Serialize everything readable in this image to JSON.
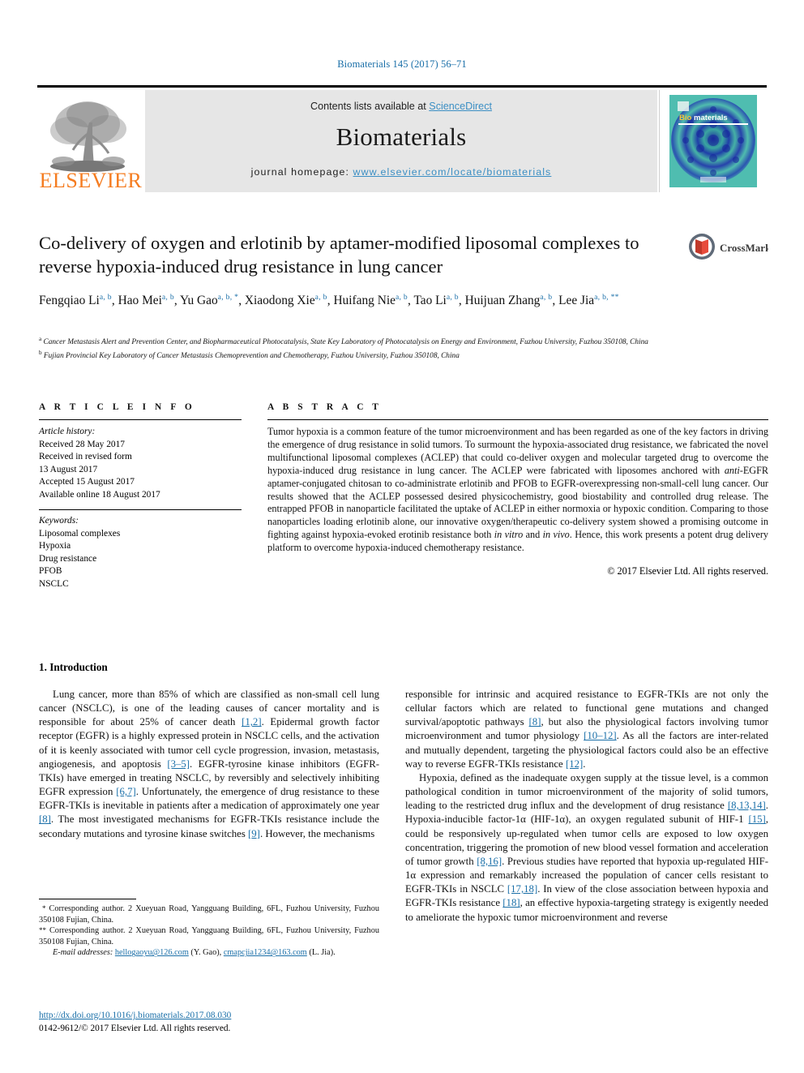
{
  "running_head": "Biomaterials 145 (2017) 56–71",
  "masthead": {
    "contents_prefix": "Contents lists available at ",
    "contents_link": "ScienceDirect",
    "journal_name": "Biomaterials",
    "homepage_prefix": "journal homepage: ",
    "homepage_url": "www.elsevier.com/locate/biomaterials",
    "publisher_logo_text": "ELSEVIER",
    "cover_title_a": "Bio",
    "cover_title_b": "materials"
  },
  "article": {
    "title": "Co-delivery of oxygen and erlotinib by aptamer-modified liposomal complexes to reverse hypoxia-induced drug resistance in lung cancer",
    "crossmark_label": "CrossMark",
    "authors": [
      {
        "name": "Fengqiao Li",
        "marks": "a, b",
        "sep": ", "
      },
      {
        "name": "Hao Mei",
        "marks": "a, b",
        "sep": ", "
      },
      {
        "name": "Yu Gao",
        "marks": "a, b, *",
        "sep": ", "
      },
      {
        "name": "Xiaodong Xie",
        "marks": "a, b",
        "sep": ", "
      },
      {
        "name": "Huifang Nie",
        "marks": "a, b",
        "sep": ", "
      },
      {
        "name": "Tao Li",
        "marks": "a, b",
        "sep": ", "
      },
      {
        "name": "Huijuan Zhang",
        "marks": "a, b",
        "sep": ", "
      },
      {
        "name": "Lee Jia",
        "marks": "a, b, **",
        "sep": ""
      }
    ],
    "affiliations": [
      {
        "mark": "a",
        "text": "Cancer Metastasis Alert and Prevention Center, and Biopharmaceutical Photocatalysis, State Key Laboratory of Photocatalysis on Energy and Environment, Fuzhou University, Fuzhou 350108, China"
      },
      {
        "mark": "b",
        "text": "Fujian Provincial Key Laboratory of Cancer Metastasis Chemoprevention and Chemotherapy, Fuzhou University, Fuzhou 350108, China"
      }
    ]
  },
  "article_info": {
    "heading": "A R T I C L E   I N F O",
    "history_label": "Article history:",
    "history": [
      "Received 28 May 2017",
      "Received in revised form",
      "13 August 2017",
      "Accepted 15 August 2017",
      "Available online 18 August 2017"
    ],
    "keywords_label": "Keywords:",
    "keywords": [
      "Liposomal complexes",
      "Hypoxia",
      "Drug resistance",
      "PFOB",
      "NSCLC"
    ]
  },
  "abstract": {
    "heading": "A B S T R A C T",
    "part1": "Tumor hypoxia is a common feature of the tumor microenvironment and has been regarded as one of the key factors in driving the emergence of drug resistance in solid tumors. To surmount the hypoxia-associated drug resistance, we fabricated the novel multifunctional liposomal complexes (ACLEP) that could co-deliver oxygen and molecular targeted drug to overcome the hypoxia-induced drug resistance in lung cancer. The ACLEP were fabricated with liposomes anchored with ",
    "italic1": "anti",
    "part2": "-EGFR aptamer-conjugated chitosan to co-administrate erlotinib and PFOB to EGFR-overexpressing non-small-cell lung cancer. Our results showed that the ACLEP possessed desired physicochemistry, good biostability and controlled drug release. The entrapped PFOB in nanoparticle facilitated the uptake of ACLEP in either normoxia or hypoxic condition. Comparing to those nanoparticles loading erlotinib alone, our innovative oxygen/therapeutic co-delivery system showed a promising outcome in fighting against hypoxia-evoked erotinib resistance both ",
    "italic2": "in vitro",
    "part3": " and ",
    "italic3": "in vivo",
    "part4": ". Hence, this work presents a potent drug delivery platform to overcome hypoxia-induced chemotherapy resistance.",
    "copyright": "© 2017 Elsevier Ltd. All rights reserved."
  },
  "body": {
    "section_heading": "1. Introduction",
    "left_p1_a": "Lung cancer, more than 85% of which are classified as non-small cell lung cancer (NSCLC), is one of the leading causes of cancer mortality and is responsible for about 25% of cancer death ",
    "left_ref1": "[1,2]",
    "left_p1_b": ". Epidermal growth factor receptor (EGFR) is a highly expressed protein in NSCLC cells, and the activation of it is keenly associated with tumor cell cycle progression, invasion, metastasis, angiogenesis, and apoptosis ",
    "left_ref2": "[3–5]",
    "left_p1_c": ". EGFR-tyrosine kinase inhibitors (EGFR-TKIs) have emerged in treating NSCLC, by reversibly and selectively inhibiting EGFR expression ",
    "left_ref3": "[6,7]",
    "left_p1_d": ". Unfortunately, the emergence of drug resistance to these EGFR-TKIs is inevitable in patients after a medication of approximately one year ",
    "left_ref4": "[8]",
    "left_p1_e": ". The most investigated mechanisms for EGFR-TKIs resistance include the secondary mutations and tyrosine kinase switches ",
    "left_ref5": "[9]",
    "left_p1_f": ". However, the mechanisms",
    "right_p1_a": "responsible for intrinsic and acquired resistance to EGFR-TKIs are not only the cellular factors which are related to functional gene mutations and changed survival/apoptotic pathways ",
    "right_ref1": "[8]",
    "right_p1_b": ", but also the physiological factors involving tumor microenvironment and tumor physiology ",
    "right_ref2": "[10–12]",
    "right_p1_c": ". As all the factors are inter-related and mutually dependent, targeting the physiological factors could also be an effective way to reverse EGFR-TKIs resistance ",
    "right_ref3": "[12]",
    "right_p1_d": ".",
    "right_p2_a": "Hypoxia, defined as the inadequate oxygen supply at the tissue level, is a common pathological condition in tumor microenvironment of the majority of solid tumors, leading to the restricted drug influx and the development of drug resistance ",
    "right_ref4": "[8,13,14]",
    "right_p2_b": ". Hypoxia-inducible factor-1α (HIF-1α), an oxygen regulated subunit of HIF-1 ",
    "right_ref5": "[15]",
    "right_p2_c": ", could be responsively up-regulated when tumor cells are exposed to low oxygen concentration, triggering the promotion of new blood vessel formation and acceleration of tumor growth ",
    "right_ref6": "[8,16]",
    "right_p2_d": ". Previous studies have reported that hypoxia up-regulated HIF-1α expression and remarkably increased the population of cancer cells resistant to EGFR-TKIs in NSCLC ",
    "right_ref7": "[17,18]",
    "right_p2_e": ". In view of the close association between hypoxia and EGFR-TKIs resistance ",
    "right_ref8": "[18]",
    "right_p2_f": ", an effective hypoxia-targeting strategy is exigently needed to ameliorate the hypoxic tumor microenvironment and reverse"
  },
  "footnotes": {
    "fn1_mark": "*",
    "fn1_text": "Corresponding author. 2 Xueyuan Road, Yangguang Building, 6FL, Fuzhou University, Fuzhou 350108 Fujian, China.",
    "fn2_mark": "**",
    "fn2_text": "Corresponding author. 2 Xueyuan Road, Yangguang Building, 6FL, Fuzhou University, Fuzhou 350108 Fujian, China.",
    "email_label": "E-mail addresses:",
    "email1": "hellogaoyu@126.com",
    "email1_owner": " (Y. Gao), ",
    "email2": "cmapcjia1234@163.com",
    "email2_owner": " (L. Jia)."
  },
  "doi_block": {
    "doi_url": "http://dx.doi.org/10.1016/j.biomaterials.2017.08.030",
    "issn_line": "0142-9612/© 2017 Elsevier Ltd. All rights reserved."
  },
  "colors": {
    "link": "#1a6fa8",
    "elsevier_orange": "#f57c20",
    "masthead_gray": "#e6e6e6"
  }
}
